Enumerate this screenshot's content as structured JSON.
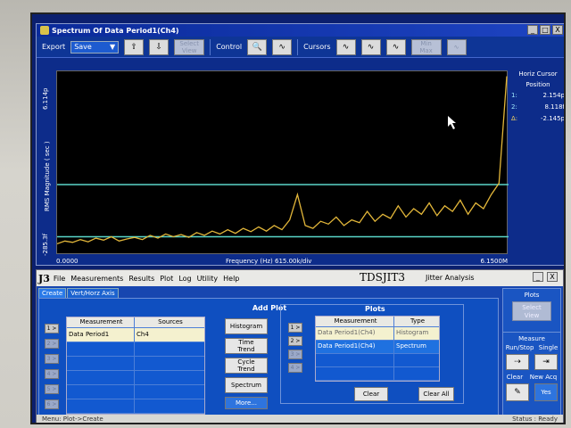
{
  "spectrum_window": {
    "title": "Spectrum Of Data Period1(Ch4)",
    "window_buttons": [
      "_",
      "□",
      "X"
    ],
    "toolbar": {
      "export_label": "Export",
      "save_value": "Save",
      "select_view": "Select\nView",
      "control_label": "Control",
      "cursors_label": "Cursors",
      "minmax": "Min\nMax"
    }
  },
  "chart_data": {
    "type": "line",
    "ylabel": "RMS Magnitude ( sec )",
    "xlabel": "Frequency (Hz)  615.00k/div",
    "x_start_label": "0.0000",
    "x_end_label": "6.1500M",
    "y_top_label": "6.114p",
    "y_bottom_label": "-285.3f",
    "xlim": [
      0,
      6.15
    ],
    "ylim": [
      -0.2853,
      6.114
    ],
    "grid": false,
    "series": [
      {
        "values": [
          0.05,
          0.15,
          0.1,
          0.2,
          0.12,
          0.25,
          0.18,
          0.3,
          0.15,
          0.22,
          0.28,
          0.2,
          0.35,
          0.25,
          0.4,
          0.3,
          0.38,
          0.28,
          0.45,
          0.35,
          0.5,
          0.4,
          0.55,
          0.42,
          0.6,
          0.48,
          0.65,
          0.5,
          0.7,
          0.55,
          0.9,
          1.8,
          0.7,
          0.6,
          0.85,
          0.75,
          1.0,
          0.7,
          0.9,
          0.8,
          1.2,
          0.85,
          1.1,
          0.95,
          1.4,
          1.0,
          1.3,
          1.1,
          1.5,
          1.05,
          1.4,
          1.2,
          1.6,
          1.1,
          1.5,
          1.3,
          1.8,
          2.2,
          6.0
        ]
      }
    ],
    "cursor_lines": [
      2.154,
      0.3
    ]
  },
  "horiz_cursor": {
    "title": "Horiz Cursor",
    "position_label": "Position",
    "rows": [
      {
        "key": "1:",
        "value": "2.154p"
      },
      {
        "key": "2:",
        "value": "8.118f"
      },
      {
        "key": "Δ:",
        "value": "-2.145p"
      }
    ]
  },
  "app": {
    "logo": "J3",
    "menu": [
      "File",
      "Measurements",
      "Results",
      "Plot",
      "Log",
      "Utility",
      "Help"
    ],
    "name": "TDSJIT3",
    "subtitle": "Jitter Analysis",
    "tabs": [
      "Create",
      "Vert/Horz Axis"
    ],
    "row_buttons": [
      "1 >",
      "2 >",
      "3 >",
      "4 >",
      "5 >",
      "6 >"
    ],
    "measurement_table": {
      "headers": [
        "Measurement",
        "Sources"
      ],
      "rows": [
        [
          "Data Period1",
          "Ch4"
        ],
        [
          "",
          ""
        ],
        [
          "",
          ""
        ],
        [
          "",
          ""
        ],
        [
          "",
          ""
        ],
        [
          "",
          ""
        ]
      ]
    },
    "add_plot": {
      "title": "Add Plot",
      "buttons": [
        "Histogram",
        "Time\nTrend",
        "Cycle\nTrend",
        "Spectrum",
        "More..."
      ]
    },
    "plots": {
      "title": "Plots",
      "row_buttons": [
        "1 >",
        "2 >",
        "3 >",
        "4 >"
      ],
      "headers": [
        "Measurement",
        "Type"
      ],
      "rows": [
        [
          "Data Period1(Ch4)",
          "Histogram"
        ],
        [
          "Data Period1(Ch4)",
          "Spectrum"
        ],
        [
          "",
          ""
        ],
        [
          "",
          ""
        ]
      ],
      "clear": "Clear",
      "clear_all": "Clear All"
    },
    "side": {
      "plots_title": "Plots",
      "select_view": "Select\nView",
      "measure_title": "Measure",
      "run_stop": "Run/Stop",
      "single": "Single",
      "clear": "Clear",
      "new_acq": "New Acq",
      "yes": "Yes"
    },
    "status_left": "Menu: Plot->Create",
    "status_right": "Status : Ready"
  },
  "colors": {
    "trace": "#e3b73a",
    "cursor": "#5ad6c9",
    "plot_bg": "#000000",
    "window_bg": "#0d2c8a"
  }
}
